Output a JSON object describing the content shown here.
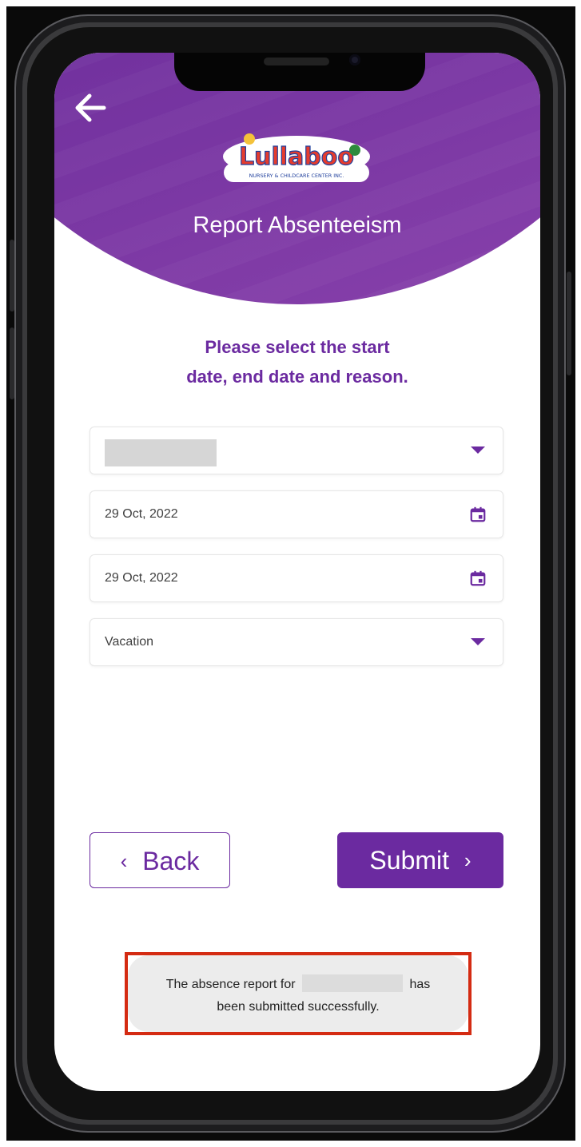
{
  "header": {
    "title": "Report Absenteeism",
    "logo_text": "Lullaboo",
    "logo_subtext": "NURSERY & CHILDCARE CENTER INC.",
    "back_icon": "arrow-left-icon"
  },
  "instruction": {
    "line1": "Please select the start",
    "line2": "date, end date and reason."
  },
  "form": {
    "child_select": {
      "value": "",
      "icon": "caret-down-icon"
    },
    "start_date": {
      "value": "29 Oct, 2022",
      "icon": "calendar-icon"
    },
    "end_date": {
      "value": "29 Oct, 2022",
      "icon": "calendar-icon"
    },
    "reason_select": {
      "value": "Vacation",
      "icon": "caret-down-icon"
    }
  },
  "buttons": {
    "back_label": "Back",
    "back_chevron": "‹",
    "submit_label": "Submit",
    "submit_chevron": "›"
  },
  "toast": {
    "prefix": "The absence report for",
    "suffix": "has",
    "line2": "been submitted successfully."
  },
  "colors": {
    "brand_purple": "#6b2aa0",
    "highlight_red": "#d42b12"
  }
}
